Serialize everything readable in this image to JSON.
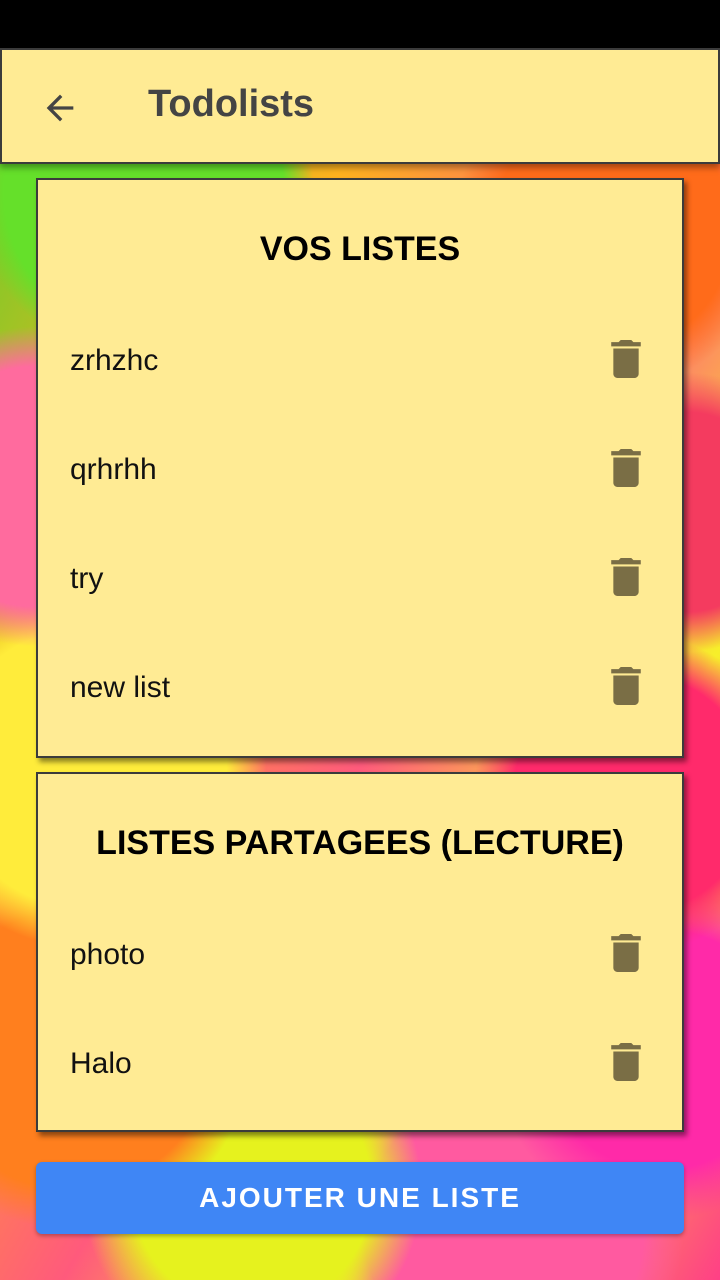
{
  "appbar": {
    "title": "Todolists",
    "back_icon": "arrow-left-icon"
  },
  "my_lists": {
    "title": "VOS LISTES",
    "items": [
      {
        "label": "zrhzhc",
        "icon": "trash-icon"
      },
      {
        "label": "qrhrhh",
        "icon": "trash-icon"
      },
      {
        "label": "try",
        "icon": "trash-icon"
      },
      {
        "label": "new list",
        "icon": "trash-icon"
      }
    ]
  },
  "shared_lists": {
    "title": "LISTES PARTAGEES (LECTURE)",
    "items": [
      {
        "label": "photo",
        "icon": "trash-icon"
      },
      {
        "label": "Halo",
        "icon": "trash-icon"
      }
    ]
  },
  "add_button": {
    "label": "AJOUTER UNE LISTE"
  },
  "colors": {
    "card_bg": "#ffeb94",
    "accent": "#3f86f5",
    "icon": "#7a6e45"
  }
}
